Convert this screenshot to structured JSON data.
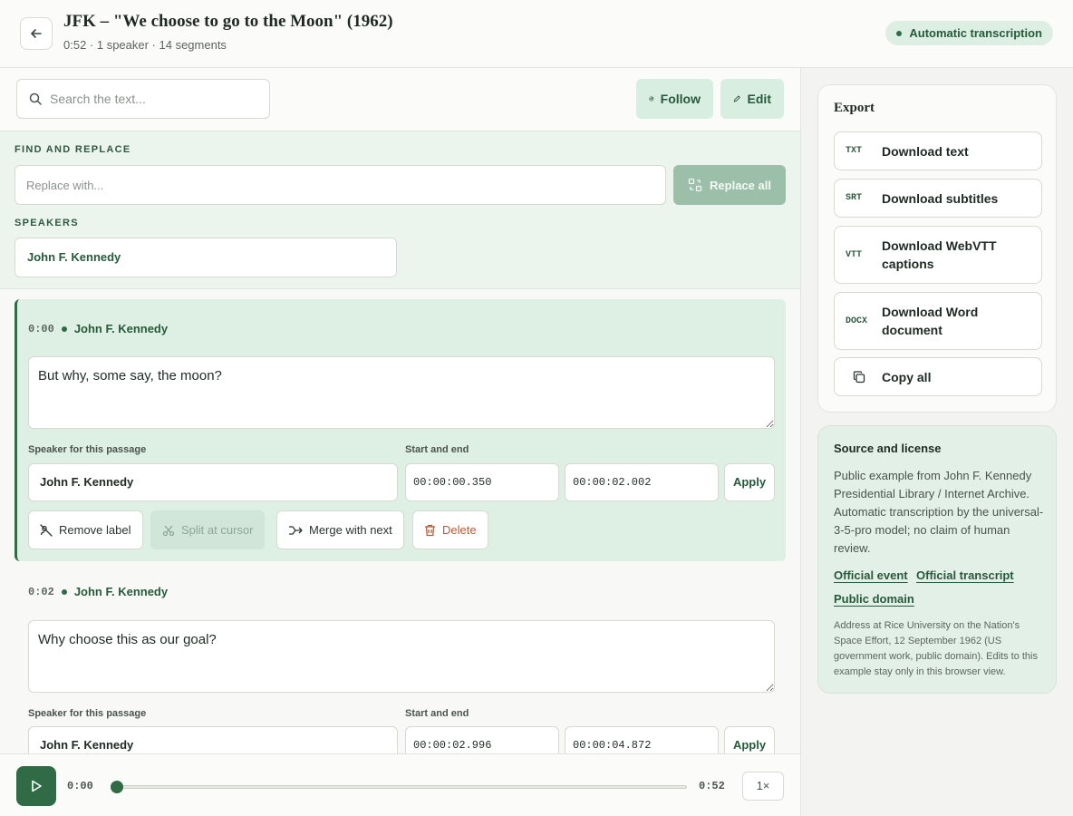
{
  "header": {
    "title": "JFK – \"We choose to go to the Moon\" (1962)",
    "subtitle": "0:52 · 1 speaker · 14 segments",
    "badge": "Automatic transcription"
  },
  "toolbar": {
    "search_placeholder": "Search the text...",
    "follow_label": "Follow",
    "edit_label": "Edit"
  },
  "tools": {
    "find_replace_label": "FIND AND REPLACE",
    "replace_placeholder": "Replace with...",
    "replace_all_label": "Replace all",
    "speakers_label": "SPEAKERS",
    "speakers": [
      "John F. Kennedy"
    ]
  },
  "segments": [
    {
      "time": "0:00",
      "speaker": "John F. Kennedy",
      "text": "But why, some say, the moon?",
      "speaker_field_label": "Speaker for this passage",
      "timing_label": "Start and end",
      "speaker_value": "John F. Kennedy",
      "start": "00:00:00.350",
      "end": "00:00:02.002",
      "apply_label": "Apply",
      "actions": {
        "remove_label": "Remove label",
        "split": "Split at cursor",
        "merge": "Merge with next",
        "delete": "Delete"
      }
    },
    {
      "time": "0:02",
      "speaker": "John F. Kennedy",
      "text": "Why choose this as our goal?",
      "speaker_field_label": "Speaker for this passage",
      "timing_label": "Start and end",
      "speaker_value": "John F. Kennedy",
      "start": "00:00:02.996",
      "end": "00:00:04.872",
      "apply_label": "Apply"
    }
  ],
  "player": {
    "current_time": "0:00",
    "total_time": "0:52",
    "speed": "1×",
    "progress": 0
  },
  "export": {
    "title": "Export",
    "items": [
      {
        "format": "TXT",
        "label": "Download text"
      },
      {
        "format": "SRT",
        "label": "Download subtitles"
      },
      {
        "format": "VTT",
        "label": "Download WebVTT captions"
      },
      {
        "format": "DOCX",
        "label": "Download Word document"
      },
      {
        "icon": "copy-icon",
        "label": "Copy all"
      }
    ]
  },
  "source": {
    "title": "Source and license",
    "text": "Public example from John F. Kennedy Presidential Library / Internet Archive. Automatic transcription by the universal-3-5-pro model; no claim of human review.",
    "links": [
      "Official event",
      "Official transcript",
      "Public domain"
    ],
    "note": "Address at Rice University on the Nation's Space Effort, 12 September 1962 (US government work, public domain). Edits to this example stay only in this browser view."
  },
  "colors": {
    "accent": "#2f6b45",
    "accent_light": "#ddf0e3",
    "danger": "#b55a33"
  }
}
